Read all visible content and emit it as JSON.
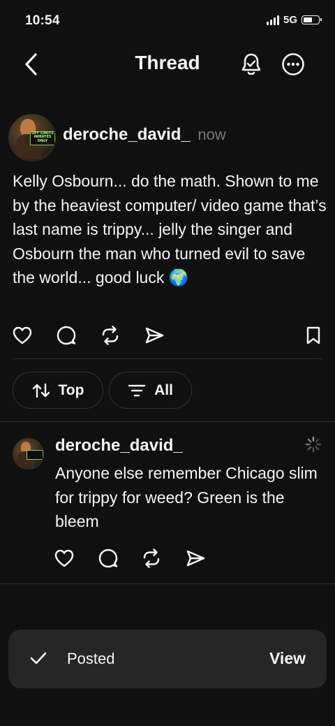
{
  "status_bar": {
    "time": "10:54",
    "network": "5G"
  },
  "header": {
    "title": "Thread"
  },
  "post": {
    "username": "deroche_david_",
    "timestamp": "now",
    "avatar_sign_line1": "OFF LIMITS",
    "avatar_sign_line2": "INMATES ONLY",
    "text": "Kelly Osbourn... do the math. Shown to me by the heaviest computer/ video game that’s last name is trippy... jelly the singer and Osbourn the man who turned evil to save the world... good luck 🌍"
  },
  "sort": {
    "top_label": "Top",
    "filter_label": "All"
  },
  "reply": {
    "username": "deroche_david_",
    "text": "Anyone else remember Chicago slim for trippy for weed? Green is the bleem"
  },
  "toast": {
    "message": "Posted",
    "action": "View"
  },
  "icons": {
    "back": "chevron-left-icon",
    "notify": "bell-icon",
    "more": "more-icon",
    "like": "heart-icon",
    "reply": "comment-icon",
    "repost": "repost-icon",
    "share": "send-icon",
    "save": "bookmark-icon",
    "posting": "spinner-icon",
    "done": "check-icon"
  },
  "colors": {
    "background": "#101010",
    "text": "#f3f5f7",
    "muted": "#777777",
    "toast": "#262626"
  }
}
